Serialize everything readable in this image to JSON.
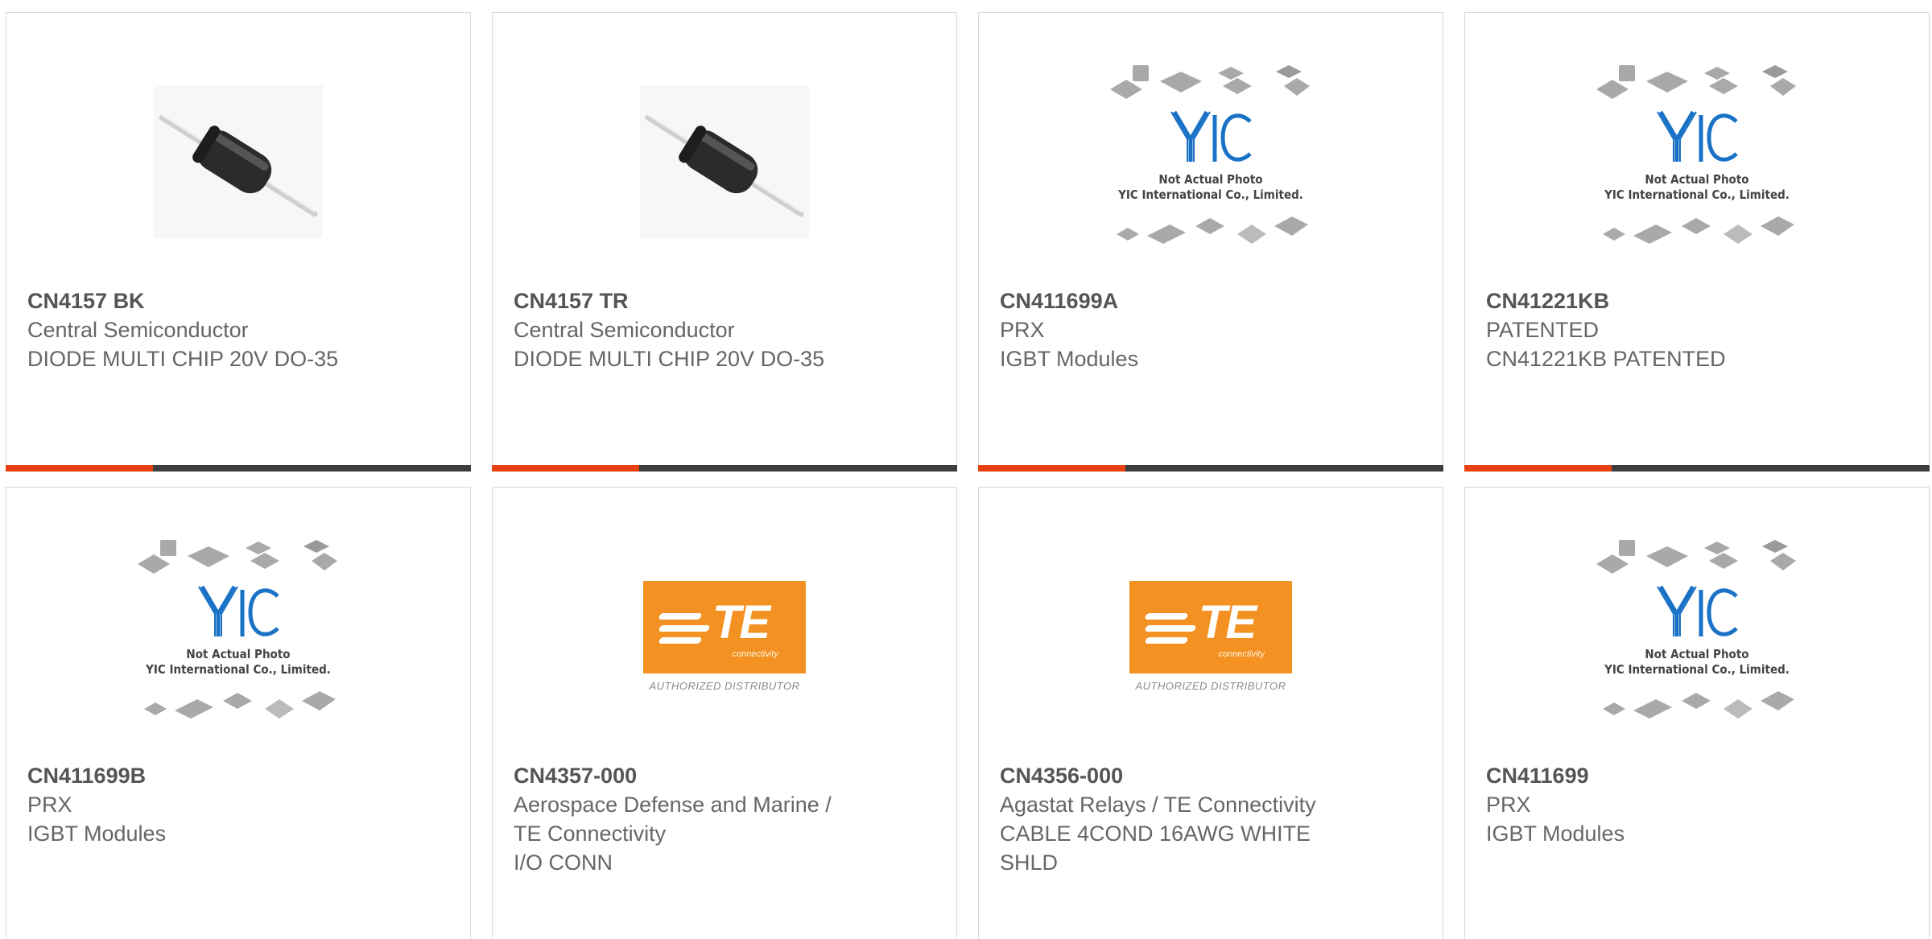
{
  "colors": {
    "accent": "#e8410f",
    "bar": "#3d3d3d",
    "te_orange": "#f39222",
    "yic_blue": "#1a72c6"
  },
  "yic_placeholder": {
    "line1": "Not Actual Photo",
    "line2": "YIC International Co., Limited."
  },
  "te_logo": {
    "brand": "TE",
    "sub": "connectivity",
    "authorized": "AUTHORIZED DISTRIBUTOR"
  },
  "products": [
    {
      "part_number": "CN4157 BK",
      "lines": [
        "Central Semiconductor",
        "DIODE MULTI CHIP 20V DO-35"
      ],
      "image": "diode-photo"
    },
    {
      "part_number": "CN4157 TR",
      "lines": [
        "Central Semiconductor",
        "DIODE MULTI CHIP 20V DO-35"
      ],
      "image": "diode-photo"
    },
    {
      "part_number": "CN411699A",
      "lines": [
        "PRX",
        "IGBT Modules"
      ],
      "image": "yic-placeholder"
    },
    {
      "part_number": "CN41221KB",
      "lines": [
        "PATENTED",
        "CN41221KB PATENTED"
      ],
      "image": "yic-placeholder"
    },
    {
      "part_number": "CN411699B",
      "lines": [
        "PRX",
        "IGBT Modules"
      ],
      "image": "yic-placeholder"
    },
    {
      "part_number": "CN4357-000",
      "lines": [
        "Aerospace Defense and Marine /",
        "TE Connectivity",
        "I/O CONN"
      ],
      "image": "te-logo"
    },
    {
      "part_number": "CN4356-000",
      "lines": [
        "Agastat Relays / TE Connectivity",
        "CABLE 4COND 16AWG WHITE",
        "SHLD"
      ],
      "image": "te-logo"
    },
    {
      "part_number": "CN411699",
      "lines": [
        "PRX",
        "IGBT Modules"
      ],
      "image": "yic-placeholder"
    }
  ]
}
